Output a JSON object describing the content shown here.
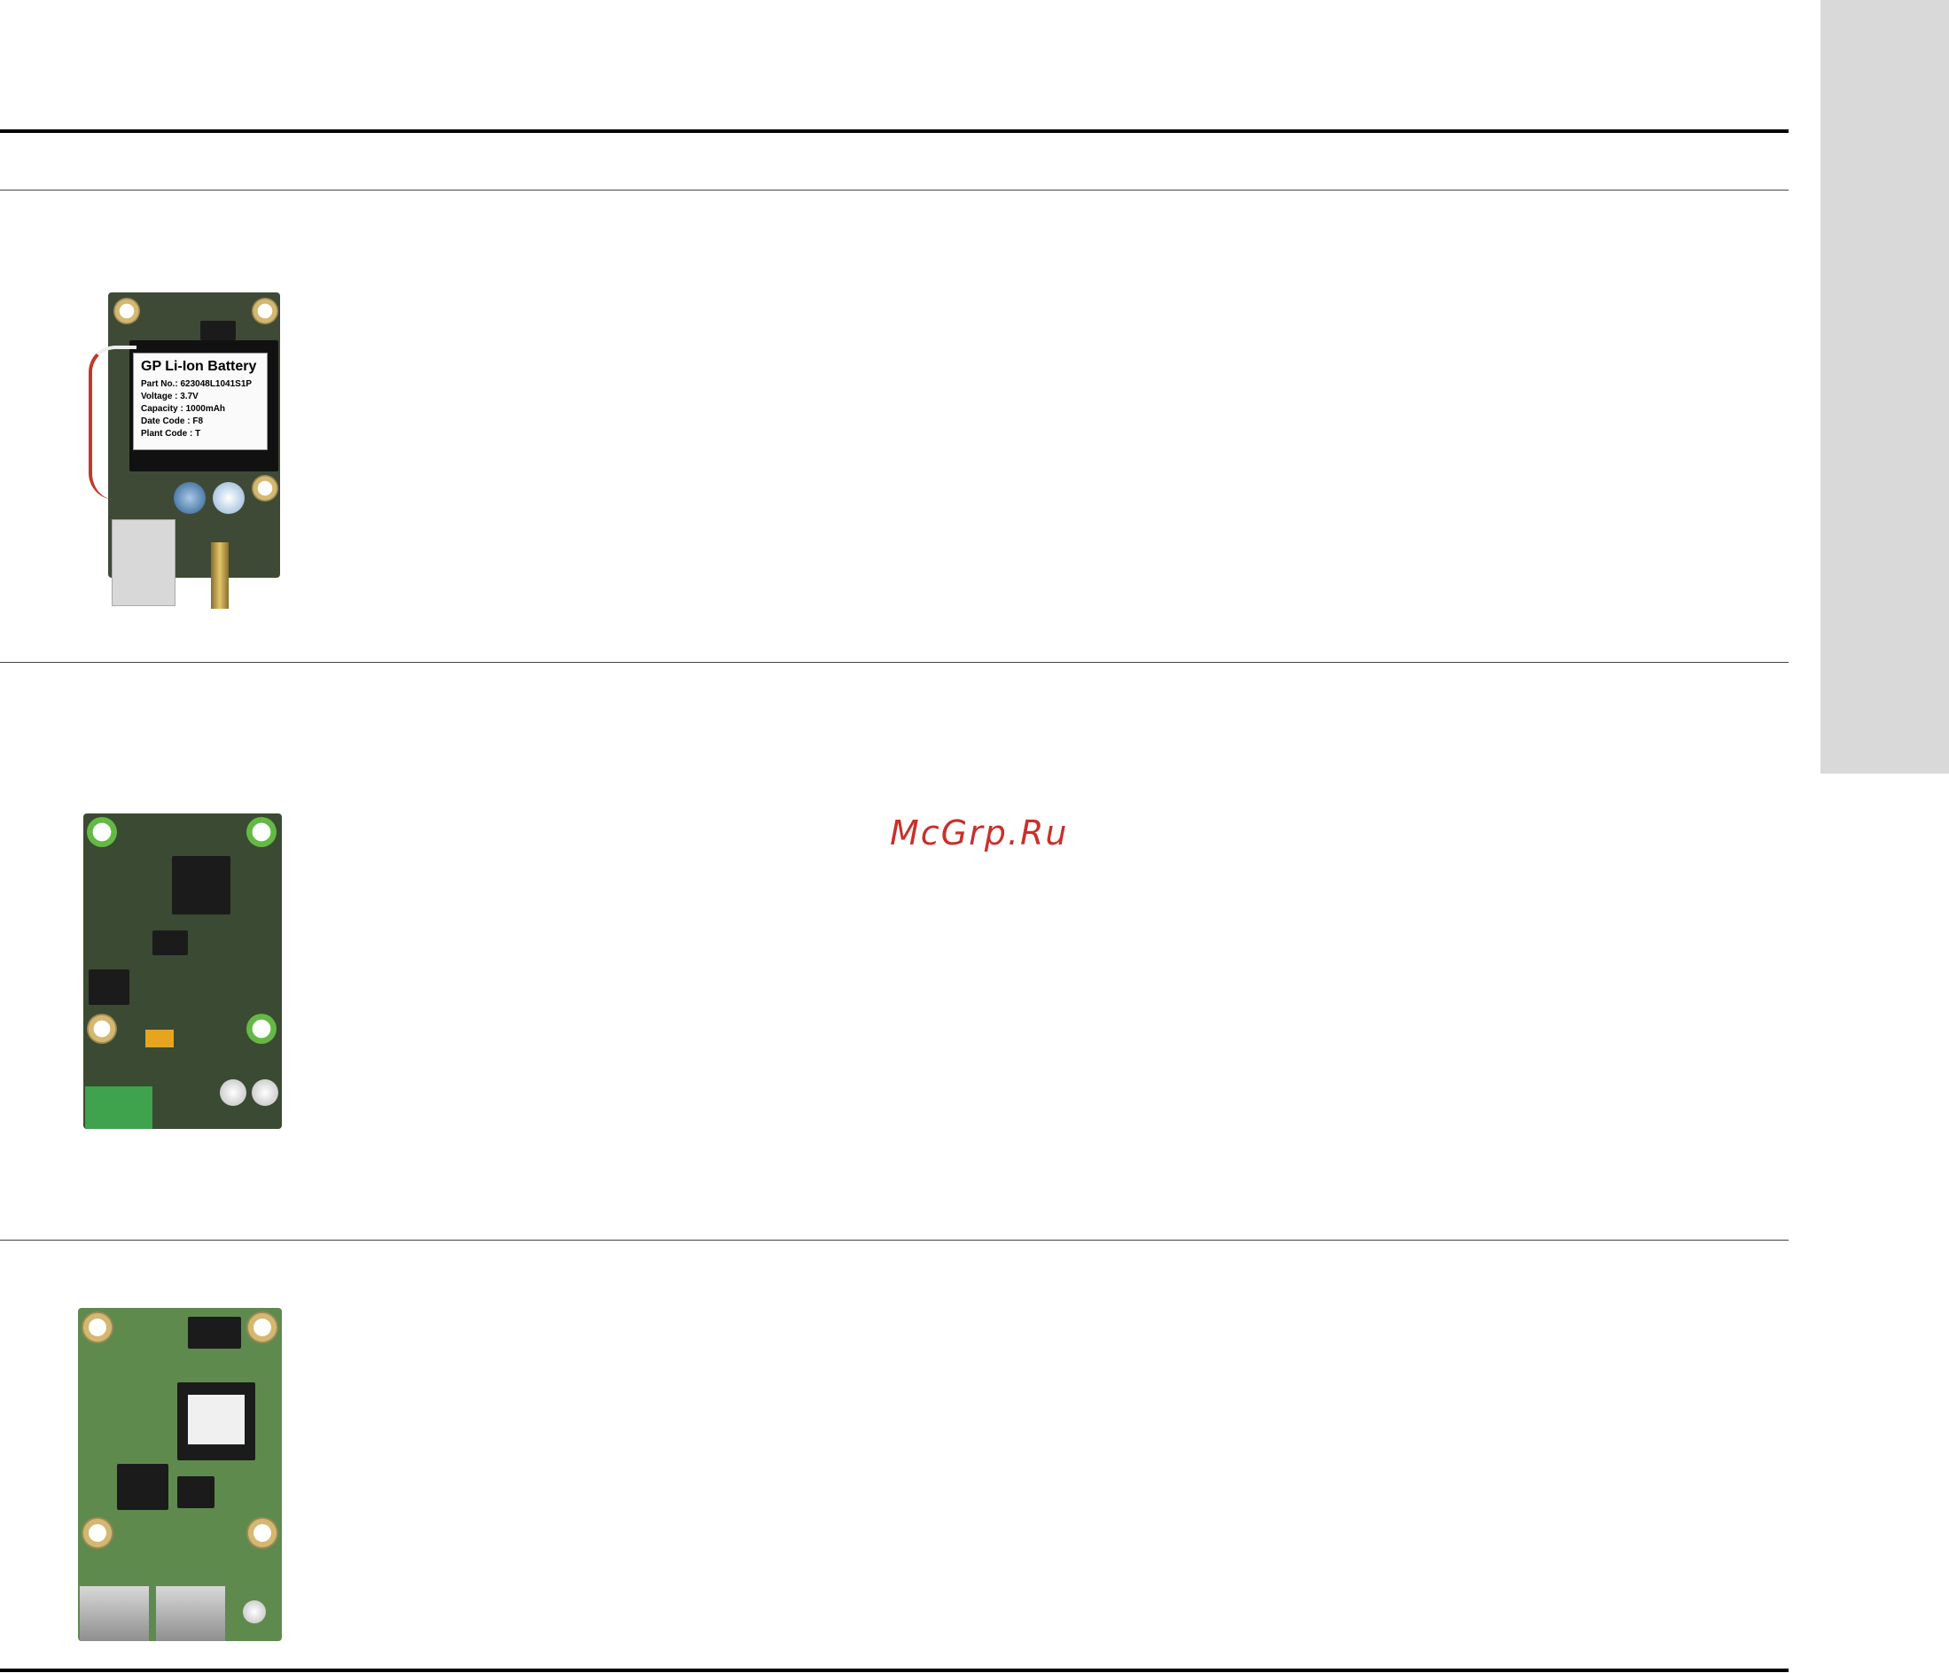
{
  "watermark": {
    "text": "McGrp.Ru"
  },
  "modules": [
    {
      "battery_label": {
        "title": "GP Li-Ion Battery",
        "lines": [
          "Part No.: 623048L1041S1P",
          "Voltage : 3.7V",
          "Capacity : 1000mAh",
          "Date Code : F8",
          "Plant Code : T"
        ]
      }
    },
    {},
    {}
  ],
  "colors": {
    "tab_strip": "#d9d9d9",
    "pcb_dark": "#3f4a36",
    "pcb_green": "#5f8a4e",
    "watermark": "#c9302c"
  }
}
